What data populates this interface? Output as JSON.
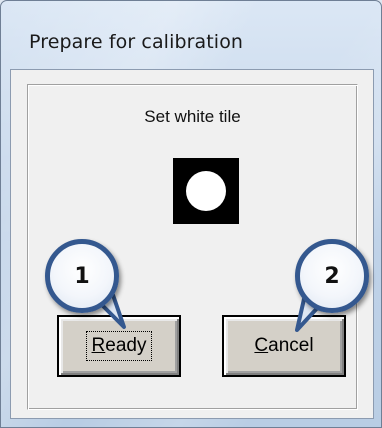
{
  "window": {
    "title": "Prepare for calibration"
  },
  "dialog": {
    "instruction": "Set white tile",
    "tile_icon": "white-tile-indicator-icon"
  },
  "buttons": {
    "ready": {
      "mnemonic": "R",
      "rest": "eady",
      "focused": true
    },
    "cancel": {
      "mnemonic": "C",
      "rest": "ancel",
      "focused": false
    }
  },
  "callouts": [
    {
      "number": "1"
    },
    {
      "number": "2"
    }
  ],
  "colors": {
    "callout_border": "#34588f",
    "tile_background": "#000000",
    "tile_dot": "#ffffff",
    "button_face": "#d4d0c8"
  }
}
